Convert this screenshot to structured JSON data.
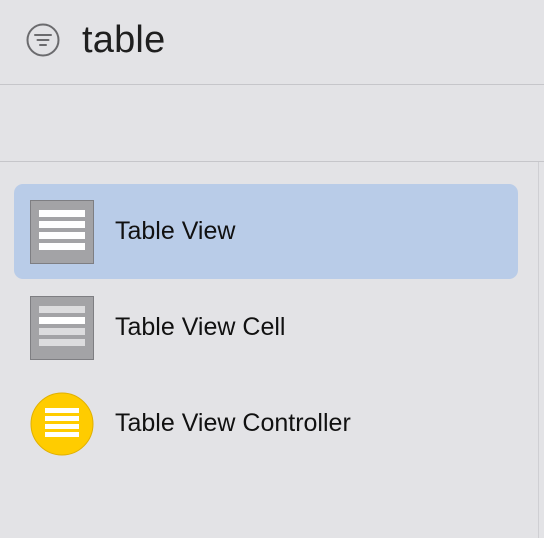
{
  "search": {
    "query": "table",
    "filter_icon": "filter-icon"
  },
  "library": {
    "items": [
      {
        "label": "Table View",
        "icon": "table-view-icon",
        "selected": true
      },
      {
        "label": "Table View Cell",
        "icon": "table-view-cell-icon",
        "selected": false
      },
      {
        "label": "Table View Controller",
        "icon": "table-view-controller-icon",
        "selected": false
      }
    ]
  },
  "colors": {
    "background": "#e3e3e6",
    "selection": "#b9cce8",
    "icon_gray": "#a3a3a6",
    "controller_yellow": "#ffcc00"
  }
}
